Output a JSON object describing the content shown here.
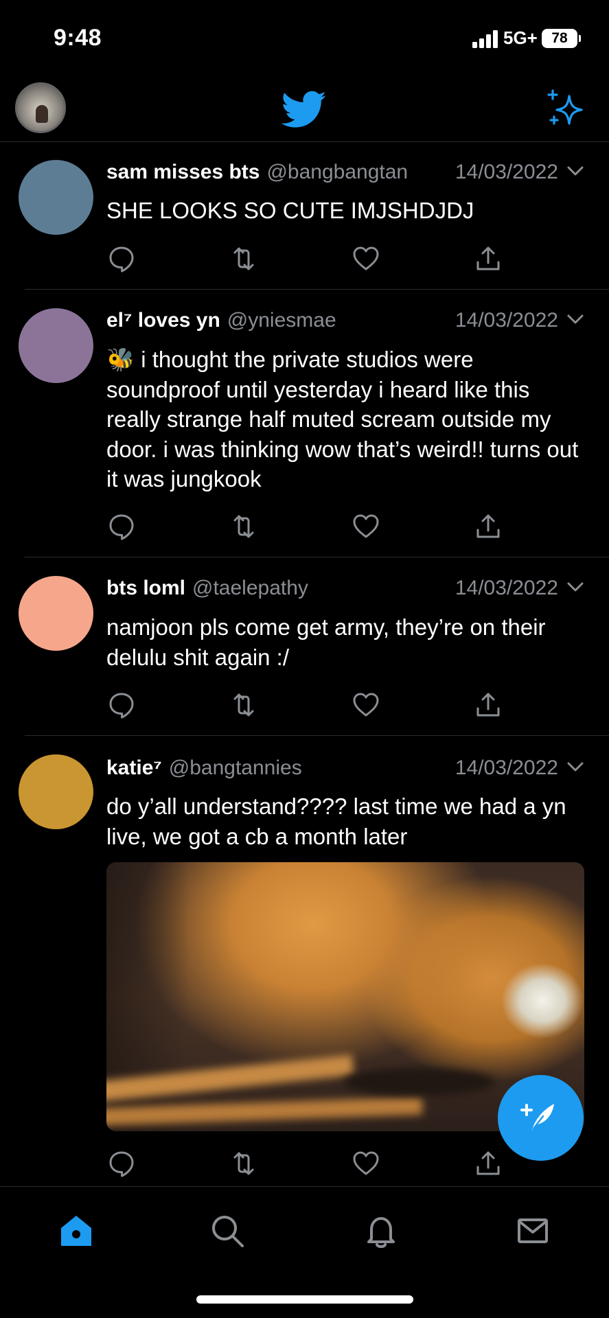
{
  "status_bar": {
    "time": "9:48",
    "network": "5G+",
    "battery": "78"
  },
  "header": {
    "logo": "twitter-bird-icon",
    "right_icon": "sparkle-icon"
  },
  "colors": {
    "accent": "#1d9bf0",
    "secondary_text": "#8b8f94",
    "background": "#000000"
  },
  "tweets": [
    {
      "name": "sam misses bts",
      "handle": "@bangbangtan",
      "date": "14/03/2022",
      "text": "SHE LOOKS SO CUTE IMJSHDJDJ",
      "avatar_color": "#5d7d95"
    },
    {
      "name": "el⁷ loves yn",
      "handle": "@yniesmae",
      "date": "14/03/2022",
      "emoji": "🐝",
      "text": "i thought the private studios were soundproof until yesterday i heard like this really strange half muted scream outside my door. i was thinking wow that’s weird!! turns out it was jungkook",
      "avatar_color": "#8c7499"
    },
    {
      "name": "bts loml",
      "handle": "@taelepathy",
      "date": "14/03/2022",
      "text": "namjoon pls come get army, they’re on their delulu shit again :/",
      "avatar_color": "#f6a68b"
    },
    {
      "name": "katie⁷",
      "handle": "@bangtannies",
      "date": "14/03/2022",
      "text": "do y’all understand???? last time we had a yn live, we got a cb a month later",
      "avatar_color": "#c99632",
      "has_media": true
    }
  ],
  "compose_button": "compose-tweet-icon",
  "tab_bar": [
    "home-icon",
    "search-icon",
    "notifications-bell-icon",
    "messages-envelope-icon"
  ]
}
